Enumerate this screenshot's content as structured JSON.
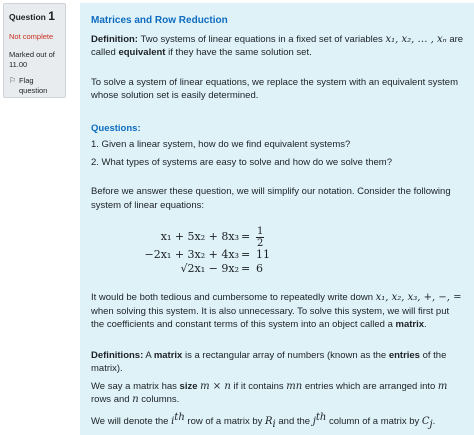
{
  "question": {
    "label": "Question",
    "number": "1",
    "state": "Not complete",
    "grade": "Marked out of 11.00",
    "flag_label": "Flag question",
    "flag_icon": "flag-icon"
  },
  "content": {
    "title": "Matrices and Row Reduction",
    "definition_label": "Definition:",
    "definition_text_1": "Two systems of linear equations in a fixed set of variables",
    "definition_vars": "x₁, x₂, … , xₙ",
    "definition_text_2": "are called",
    "definition_term": "equivalent",
    "definition_text_3": "if they have the same solution set.",
    "para_solve": "To solve a system of linear equations, we replace the system with an equivalent system whose solution set is easily determined.",
    "questions_label": "Questions:",
    "question_1": "1. Given a linear system, how do we find equivalent systems?",
    "question_2": "2. What types of systems are easy to solve and how do we solve them?",
    "para_notation": "Before we answer these question, we will simplify our notation. Consider the following system of linear equations:",
    "equations": [
      {
        "lhs": "x₁ + 5x₂ + 8x₃",
        "rhs_num": "1",
        "rhs_den": "2"
      },
      {
        "lhs": "−2x₁ + 3x₂ + 4x₃",
        "rhs": "11"
      },
      {
        "lhs": "√2x₁ − 9x₂",
        "rhs": "6"
      }
    ],
    "equals": "=",
    "para_tedious_1": "It would be both tedious and cumbersome to repeatedly write down",
    "tedious_symbols": "x₁, x₂, x₃, +, −, =",
    "para_tedious_2": "when solving this system.  It is also unnecessary.  To solve this system, we will first put the coefficients and constant terms of this system into an object called a",
    "tedious_term": "matrix",
    "definitions_label": "Definitions:",
    "def_matrix_1": "A",
    "def_matrix_term": "matrix",
    "def_matrix_2": "is a rectangular array of numbers (known as the",
    "def_entries_term": "entries",
    "def_matrix_3": "of the matrix).",
    "size_1": "We say a matrix has",
    "size_term": "size",
    "size_expr": "m × n",
    "size_2": "if it contains",
    "size_mn": "mn",
    "size_3": "entries which are arranged into",
    "size_m": "m",
    "size_4": "rows and",
    "size_n": "n",
    "size_5": "columns.",
    "denote_1": "We will denote the",
    "denote_i": "i",
    "denote_th1": "th",
    "denote_2": "row of a matrix by",
    "denote_R": "R",
    "denote_Ri": "i",
    "denote_3": "and the",
    "denote_j": "j",
    "denote_th2": "th",
    "denote_4": "column of a matrix by",
    "denote_C": "C",
    "denote_Cj": "j"
  }
}
